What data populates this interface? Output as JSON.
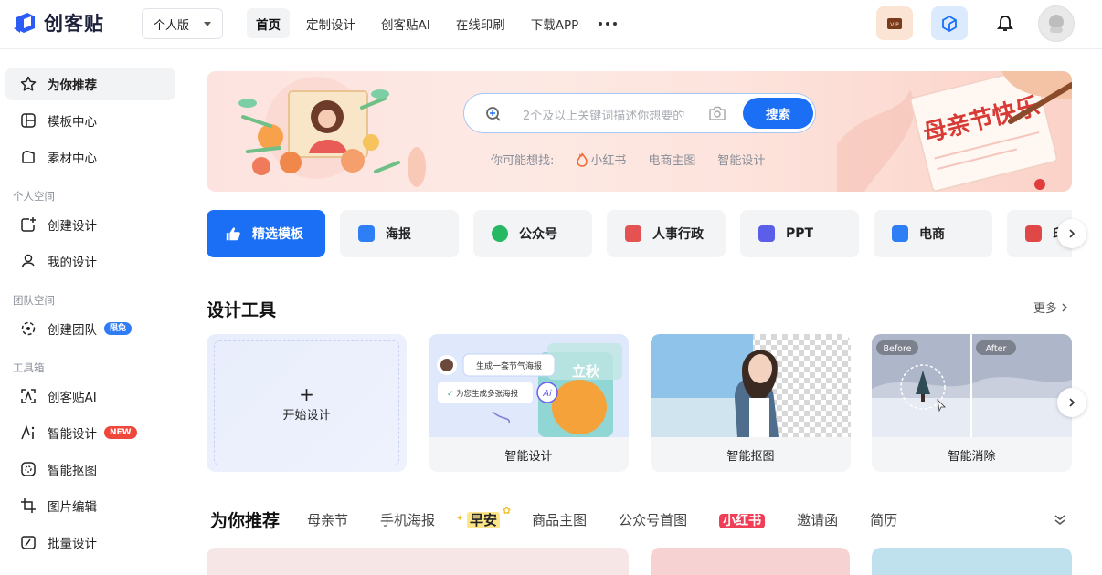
{
  "brand": {
    "name": "创客贴"
  },
  "edition": {
    "label": "个人版"
  },
  "nav": {
    "items": [
      "首页",
      "定制设计",
      "创客贴AI",
      "在线印刷",
      "下载APP"
    ]
  },
  "topbar": {
    "vip_label": "VIP"
  },
  "sidebar": {
    "top_items": [
      "为你推荐",
      "模板中心",
      "素材中心"
    ],
    "groups": [
      {
        "title": "个人空间",
        "items": [
          "创建设计",
          "我的设计"
        ]
      },
      {
        "title": "团队空间",
        "items": [
          "创建团队"
        ],
        "badge": "限免"
      },
      {
        "title": "工具箱",
        "items": [
          "创客贴AI",
          "智能设计",
          "智能抠图",
          "图片编辑",
          "批量设计"
        ],
        "badge": "NEW"
      }
    ]
  },
  "banner": {
    "search_placeholder": "2个及以上关键词描述你想要的",
    "search_button": "搜索",
    "suggest_label": "你可能想找:",
    "suggestions": [
      "小红书",
      "电商主图",
      "智能设计"
    ],
    "festival_text": "母亲节快乐"
  },
  "categories": [
    "精选模板",
    "海报",
    "公众号",
    "人事行政",
    "PPT",
    "电商",
    "印"
  ],
  "tools": {
    "title": "设计工具",
    "more": "更多",
    "items": [
      "开始设计",
      "智能设计",
      "智能抠图",
      "智能消除"
    ],
    "ai_card": {
      "prompt": "生成一套节气海报",
      "reply": "为您生成多张海报",
      "poster_text": "立秋"
    },
    "erase_card": {
      "before": "Before",
      "after": "After"
    }
  },
  "recommend": {
    "title": "为你推荐",
    "tabs": [
      "母亲节",
      "手机海报",
      "早安",
      "商品主图",
      "公众号首图",
      "小红书",
      "邀请函",
      "简历"
    ]
  },
  "colors": {
    "accent": "#1a6ff5",
    "badge_blue": "#2f7cf6",
    "badge_red": "#f0473c"
  }
}
